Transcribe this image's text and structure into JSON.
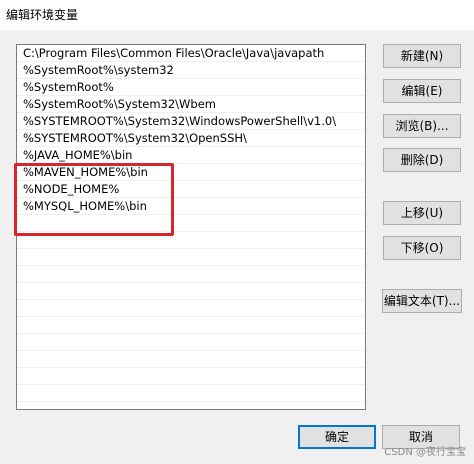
{
  "window": {
    "title": "编辑环境变量"
  },
  "list": {
    "items": [
      "C:\\Program Files\\Common Files\\Oracle\\Java\\javapath",
      "%SystemRoot%\\system32",
      "%SystemRoot%",
      "%SystemRoot%\\System32\\Wbem",
      "%SYSTEMROOT%\\System32\\WindowsPowerShell\\v1.0\\",
      "%SYSTEMROOT%\\System32\\OpenSSH\\",
      "%JAVA_HOME%\\bin",
      "%MAVEN_HOME%\\bin",
      "%NODE_HOME%",
      "%MYSQL_HOME%\\bin"
    ],
    "highlight_color": "#d9262c"
  },
  "buttons": {
    "new": "新建(N)",
    "edit": "编辑(E)",
    "browse": "浏览(B)...",
    "delete": "删除(D)",
    "move_up": "上移(U)",
    "move_down": "下移(O)",
    "edit_text": "编辑文本(T)...",
    "ok": "确定",
    "cancel": "取消"
  },
  "watermark": "CSDN @夜行宝宝"
}
